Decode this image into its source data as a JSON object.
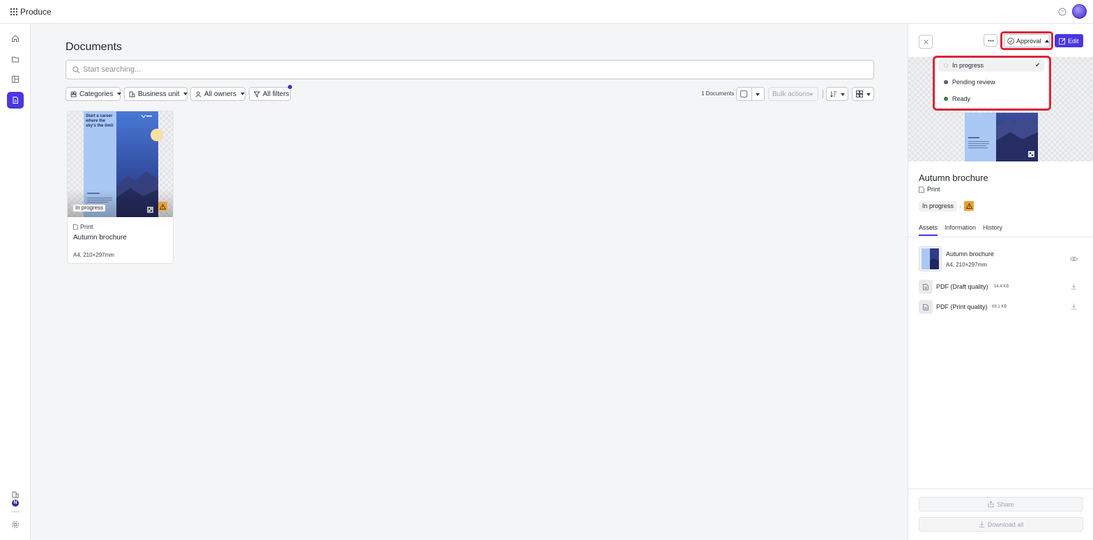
{
  "app": {
    "name": "Produce"
  },
  "main": {
    "title": "Documents",
    "search": {
      "placeholder": "Start searching..."
    },
    "filters": {
      "categories": "Categories",
      "business_unit": "Business unit",
      "owners": "All owners",
      "all_filters": "All filters"
    },
    "toolbar": {
      "count": "1 Documents",
      "bulk_actions": "Bulk actions"
    }
  },
  "documents": [
    {
      "status": "In progress",
      "type": "Print",
      "name": "Autumn brochure",
      "size": "A4, 210×297mm",
      "cover_text": "Start a career where the sky's the limit"
    }
  ],
  "panel": {
    "approval_label": "Approval",
    "edit_label": "Edit",
    "title": "Autumn brochure",
    "type": "Print",
    "status": "In progress",
    "tabs": [
      "Assets",
      "Information",
      "History"
    ],
    "asset": {
      "name": "Autumn brochure",
      "size": "A4, 210×297mm"
    },
    "files": [
      {
        "name": "PDF (Draft quality)",
        "size": "54.4 KB"
      },
      {
        "name": "PDF (Print quality)",
        "size": "69.1 KB"
      }
    ],
    "share_label": "Share",
    "download_label": "Download all"
  },
  "approval_menu": {
    "items": [
      {
        "label": "In progress",
        "selected": true,
        "color": "#ffffff"
      },
      {
        "label": "Pending review",
        "selected": false,
        "color": "#5b6270"
      },
      {
        "label": "Ready",
        "selected": false,
        "color": "#3f7a4d"
      }
    ]
  },
  "rail": {
    "badge": "N"
  },
  "colors": {
    "accent": "#4b36e0",
    "highlight": "#d8283a",
    "warning": "#e8a13a"
  }
}
